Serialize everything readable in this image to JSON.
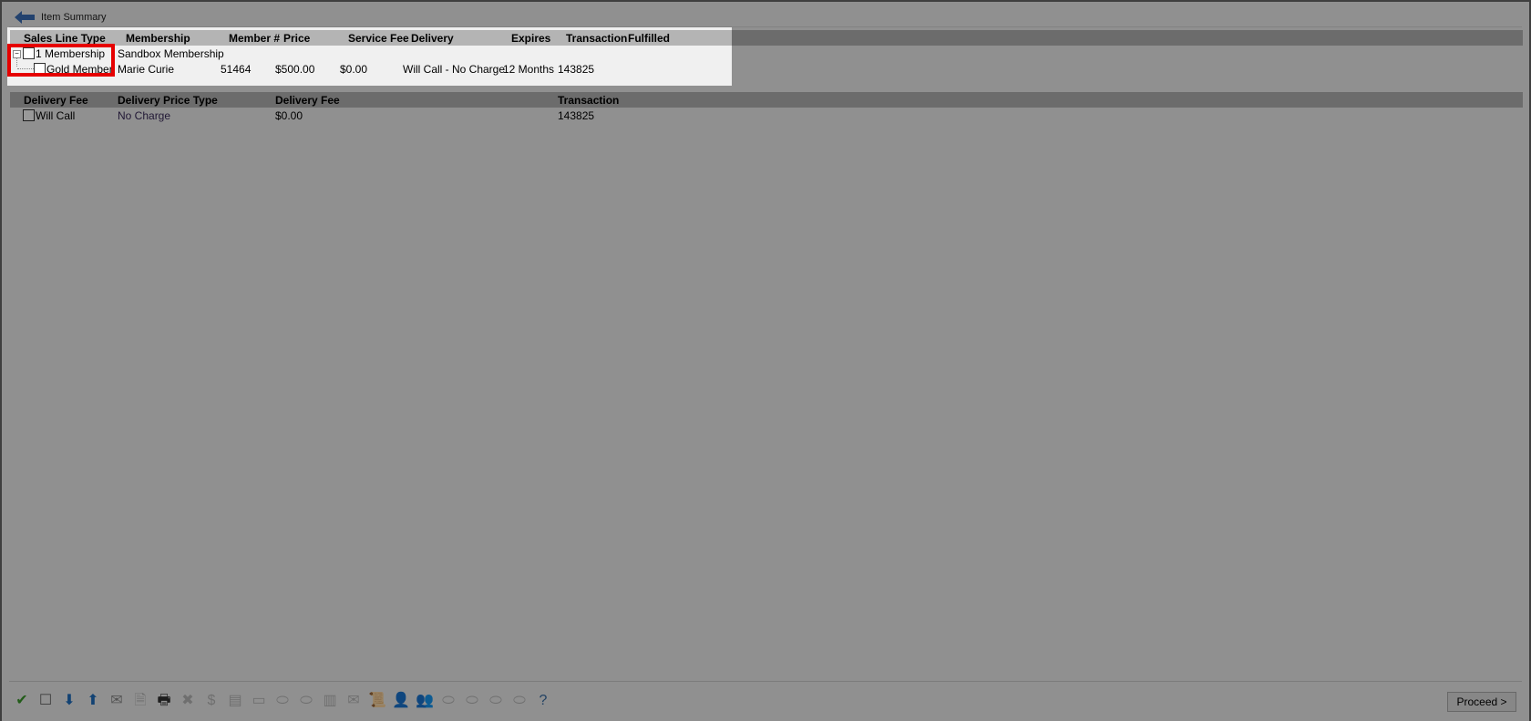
{
  "window": {
    "title": "Item Summary",
    "back_icon": "back-arrow-icon"
  },
  "grid1": {
    "headers": [
      "Sales Line Type",
      "Membership",
      "Member #",
      "Price",
      "Service Fee",
      "Delivery",
      "Expires",
      "Transaction",
      "Fulfilled"
    ],
    "rows": [
      {
        "sales_line_type": "1 Membership",
        "membership": "Sandbox Membership",
        "member_no": "",
        "price": "",
        "service_fee": "",
        "delivery": "",
        "expires": "",
        "transaction": "",
        "fulfilled": "",
        "expanded": true,
        "checked": false
      },
      {
        "sales_line_type": "Gold Member",
        "membership": "Marie Curie",
        "member_no": "51464",
        "price": "$500.00",
        "service_fee": "$0.00",
        "delivery": "Will Call - No Charge",
        "expires": "12 Months",
        "transaction": "143825",
        "fulfilled": "",
        "checked": false
      }
    ]
  },
  "grid2": {
    "headers": [
      "Delivery Fee",
      "Delivery Price Type",
      "Delivery Fee",
      "Transaction"
    ],
    "rows": [
      {
        "delivery_fee_name": "Will Call",
        "delivery_price_type": "No Charge",
        "delivery_fee": "$0.00",
        "transaction": "143825",
        "checked": false
      }
    ]
  },
  "toolbar": {
    "icons": [
      {
        "name": "check-all-icon",
        "glyph": "✔",
        "color": "#3a9a2a",
        "enabled": true
      },
      {
        "name": "uncheck-all-icon",
        "glyph": "☐",
        "color": "#666666",
        "enabled": true
      },
      {
        "name": "move-down-add-icon",
        "glyph": "⬇",
        "color": "#1e6fc0",
        "enabled": true
      },
      {
        "name": "move-up-remove-icon",
        "glyph": "⬆",
        "color": "#1e6fc0",
        "enabled": true
      },
      {
        "name": "email-info-icon",
        "glyph": "✉",
        "color": "#8a8a8a",
        "enabled": true
      },
      {
        "name": "document-info-icon",
        "glyph": "🗎",
        "enabled": false
      },
      {
        "name": "printer-icon",
        "glyph": "🖶",
        "color": "#333333",
        "enabled": true
      },
      {
        "name": "delete-icon",
        "glyph": "✖",
        "enabled": false
      },
      {
        "name": "dollar-icon",
        "glyph": "$",
        "enabled": false
      },
      {
        "name": "ticket-stack-icon",
        "glyph": "▤",
        "enabled": false
      },
      {
        "name": "card-icon",
        "glyph": "▭",
        "enabled": false
      },
      {
        "name": "ticket-icon",
        "glyph": "⬭",
        "enabled": false
      },
      {
        "name": "ticket-remove-icon",
        "glyph": "⬭",
        "enabled": false
      },
      {
        "name": "barcode-icon",
        "glyph": "▥",
        "enabled": false
      },
      {
        "name": "envelope-open-icon",
        "glyph": "✉",
        "enabled": false
      },
      {
        "name": "scroll-icon",
        "glyph": "📜",
        "enabled": false
      },
      {
        "name": "user-icon",
        "glyph": "👤",
        "enabled": false
      },
      {
        "name": "user-swap-icon",
        "glyph": "👥",
        "enabled": false
      },
      {
        "name": "ticket-tag-icon",
        "glyph": "⬭",
        "enabled": false
      },
      {
        "name": "ticket-tag-remove-icon",
        "glyph": "⬭",
        "enabled": false
      },
      {
        "name": "ticket-tag-search-icon",
        "glyph": "⬭",
        "enabled": false
      },
      {
        "name": "ticket-tag-info-icon",
        "glyph": "⬭",
        "enabled": false
      },
      {
        "name": "help-icon",
        "glyph": "?",
        "color": "#3a6ea5",
        "enabled": true
      }
    ]
  },
  "proceed_label": "Proceed >"
}
